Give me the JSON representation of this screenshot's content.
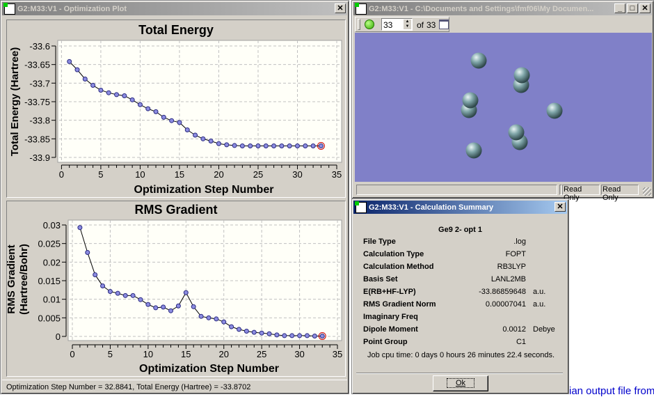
{
  "plot_window": {
    "title": "G2:M33:V1 - Optimization Plot",
    "close": "✕",
    "status": "Optimization Step Number = 32.8841,  Total Energy (Hartree) = -33.8702"
  },
  "chart_data": [
    {
      "type": "line",
      "title": "Total Energy",
      "xlabel": "Optimization Step Number",
      "ylabel": "Total Energy (Hartree)",
      "xlim": [
        0,
        35
      ],
      "ylim": [
        -33.9,
        -33.6
      ],
      "grid": true,
      "xticks": [
        "0",
        "5",
        "10",
        "15",
        "20",
        "25",
        "30",
        "35"
      ],
      "yticks": [
        "-33.6",
        "-33.65",
        "-33.7",
        "-33.75",
        "-33.8",
        "-33.85",
        "-33.9"
      ],
      "x": [
        1,
        2,
        3,
        4,
        5,
        6,
        7,
        8,
        9,
        10,
        11,
        12,
        13,
        14,
        15,
        16,
        17,
        18,
        19,
        20,
        21,
        22,
        23,
        24,
        25,
        26,
        27,
        28,
        29,
        30,
        31,
        32,
        33
      ],
      "values": [
        -33.642,
        -33.664,
        -33.689,
        -33.706,
        -33.719,
        -33.726,
        -33.731,
        -33.734,
        -33.745,
        -33.758,
        -33.769,
        -33.777,
        -33.792,
        -33.801,
        -33.806,
        -33.826,
        -33.84,
        -33.85,
        -33.856,
        -33.863,
        -33.866,
        -33.868,
        -33.869,
        -33.869,
        -33.869,
        -33.869,
        -33.869,
        -33.869,
        -33.869,
        -33.869,
        -33.869,
        -33.869,
        -33.869
      ],
      "highlight_x": 33
    },
    {
      "type": "line",
      "title": "RMS Gradient",
      "xlabel": "Optimization Step Number",
      "ylabel": "RMS Gradient (Hartree/Bohr)",
      "ylabel_lines": [
        "RMS Gradient",
        "(Hartree/Bohr)"
      ],
      "xlim": [
        0,
        35
      ],
      "ylim": [
        0,
        0.03
      ],
      "grid": true,
      "xticks": [
        "0",
        "5",
        "10",
        "15",
        "20",
        "25",
        "30",
        "35"
      ],
      "yticks": [
        "0.03",
        "0.025",
        "0.02",
        "0.015",
        "0.01",
        "0.005",
        "0"
      ],
      "x": [
        1,
        2,
        3,
        4,
        5,
        6,
        7,
        8,
        9,
        10,
        11,
        12,
        13,
        14,
        15,
        16,
        17,
        18,
        19,
        20,
        21,
        22,
        23,
        24,
        25,
        26,
        27,
        28,
        29,
        30,
        31,
        32,
        33
      ],
      "values": [
        0.0293,
        0.0226,
        0.0166,
        0.0136,
        0.0121,
        0.0116,
        0.011,
        0.011,
        0.0099,
        0.0086,
        0.0077,
        0.0079,
        0.0069,
        0.0082,
        0.0118,
        0.008,
        0.0054,
        0.005,
        0.0047,
        0.0039,
        0.0026,
        0.0019,
        0.0014,
        0.0011,
        0.0009,
        0.0007,
        0.0004,
        0.0002,
        0.0002,
        0.0002,
        0.0002,
        0.0001,
        0.0001
      ],
      "highlight_x": 33
    }
  ],
  "viewer_window": {
    "title": "G2:M33:V1 - C:\\Documents and Settings\\fmf06\\My Documen...",
    "frame": "33",
    "of_label": "of",
    "total": "33",
    "status": [
      "Read Only",
      "Read Only"
    ],
    "min": "_",
    "max": "□",
    "close": "✕",
    "bg": "#8080c8"
  },
  "summary": {
    "title": "G2:M33:V1 - Calculation Summary",
    "heading": "Ge9 2- opt 1",
    "rows": [
      {
        "k": "File Type",
        "v": ".log",
        "u": ""
      },
      {
        "k": "Calculation Type",
        "v": "FOPT",
        "u": ""
      },
      {
        "k": "Calculation Method",
        "v": "RB3LYP",
        "u": ""
      },
      {
        "k": "Basis Set",
        "v": "LANL2MB",
        "u": ""
      },
      {
        "k": "E(RB+HF-LYP)",
        "v": "-33.86859648",
        "u": "a.u."
      },
      {
        "k": "RMS Gradient Norm",
        "v": "0.00007041",
        "u": "a.u."
      },
      {
        "k": "Imaginary Freq",
        "v": "",
        "u": ""
      },
      {
        "k": "Dipole Moment",
        "v": "0.0012",
        "u": "Debye"
      },
      {
        "k": "Point Group",
        "v": "C1",
        "u": ""
      }
    ],
    "cpu": "Job cpu time:  0 days  0 hours 26 minutes 22.4 seconds.",
    "ok": "Ok",
    "close": "✕"
  },
  "background_text": "ian output file from"
}
